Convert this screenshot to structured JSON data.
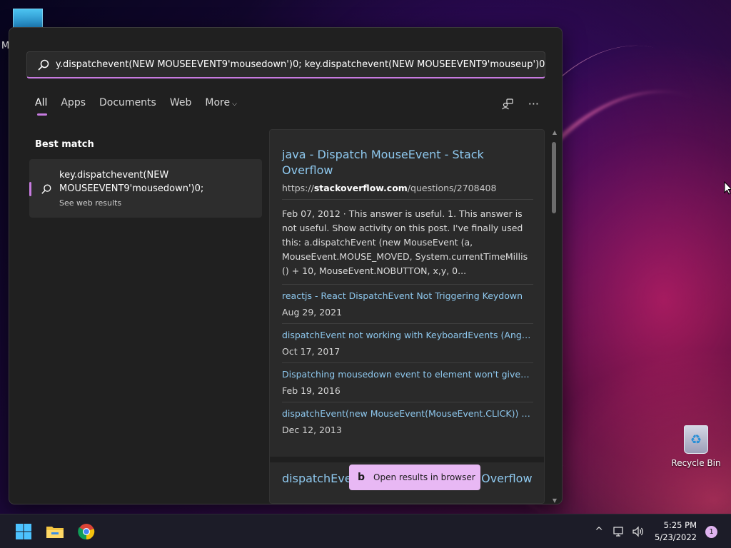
{
  "desktop": {
    "partial_icon_label": "M",
    "recycle_bin_label": "Recycle Bin"
  },
  "search": {
    "query": "y.dispatchevent(NEW MOUSEEVENT9'mousedown')0; key.dispatchevent(NEW MOUSEEVENT9'mouseup')0;",
    "placeholder": ""
  },
  "tabs": [
    {
      "label": "All",
      "active": true
    },
    {
      "label": "Apps"
    },
    {
      "label": "Documents"
    },
    {
      "label": "Web"
    },
    {
      "label": "More"
    }
  ],
  "best_match": {
    "heading": "Best match",
    "title": "key.dispatchevent(NEW MOUSEEVENT9'mousedown')0;",
    "subtitle": "See web results"
  },
  "results": {
    "main_title": "java - Dispatch MouseEvent - Stack Overflow",
    "url_prefix": "https://",
    "url_domain": "stackoverflow.com",
    "url_path": "/questions/2708408",
    "snippet": "Feb 07, 2012 · This answer is useful. 1. This answer is not useful. Show activity on this post. I've finally used this: a.dispatchEvent (new MouseEvent (a, MouseEvent.MOUSE_MOVED, System.currentTimeMillis () + 10, MouseEvent.NOBUTTON, x,y, 0...",
    "links": [
      {
        "title": "reactjs - React DispatchEvent Not Triggering Keydown",
        "date": "Aug 29, 2021"
      },
      {
        "title": "dispatchEvent not working with KeyboardEvents (Angu...",
        "date": "Oct 17, 2017"
      },
      {
        "title": "Dispatching mousedown event to element won't give i...",
        "date": "Feb 19, 2016"
      },
      {
        "title": "dispatchEvent(new MouseEvent(MouseEvent.CLICK)) d...",
        "date": "Dec 12, 2013"
      }
    ],
    "second_title": "dispatchEvent not working - Stack Overflow",
    "open_browser_label": "Open results in browser"
  },
  "taskbar": {
    "time": "5:25 PM",
    "date": "5/23/2022",
    "notification_count": "1"
  },
  "colors": {
    "accent": "#c77be0",
    "link": "#8ec8ee",
    "panel_bg": "#202020"
  }
}
